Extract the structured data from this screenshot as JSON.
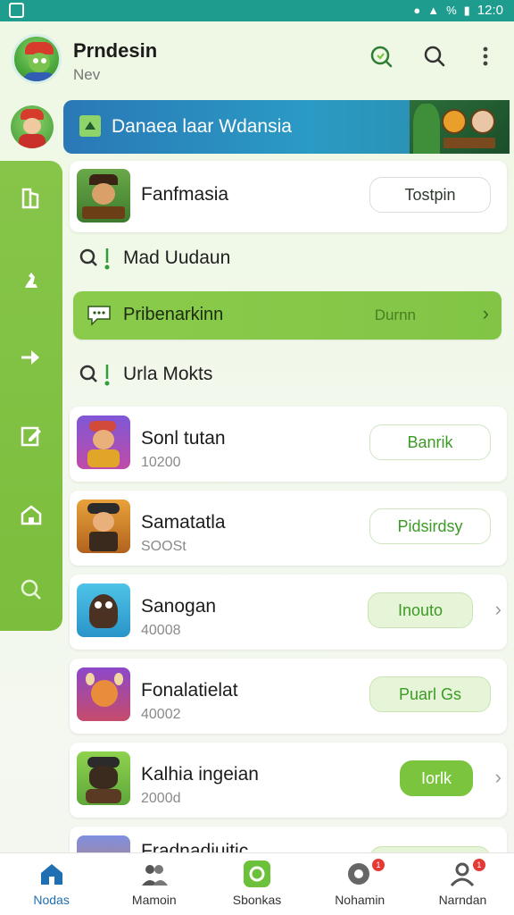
{
  "status_bar": {
    "time": "12:0",
    "signal_text": "%"
  },
  "header": {
    "title": "Prndesin",
    "subtitle": "Nev",
    "actions": [
      "refresh-search-icon",
      "search-icon",
      "more-vert-icon"
    ]
  },
  "banner": {
    "text": "Danaea laar Wdansia"
  },
  "rail": {
    "items": [
      "library-icon",
      "chess-icon",
      "forward-icon",
      "edit-icon",
      "home-icon",
      "settings-icon"
    ]
  },
  "featured": {
    "title": "Fanfmasia",
    "button": "Tostpin"
  },
  "section_1": {
    "label": "Mad Uudaun"
  },
  "highlight": {
    "label": "Pribenarkinn",
    "value": "Durnn"
  },
  "section_2": {
    "label": "Urla Mokts"
  },
  "games": [
    {
      "title": "Sonl tutan",
      "sub": "10200",
      "button": "Banrik",
      "style": "green-outline",
      "chevron": false
    },
    {
      "title": "Samatatla",
      "sub": "SOOSt",
      "button": "Pidsirdsy",
      "style": "green-outline",
      "chevron": false
    },
    {
      "title": "Sanogan",
      "sub": "40008",
      "button": "Inouto",
      "style": "green-soft",
      "chevron": true
    },
    {
      "title": "Fonalatielat",
      "sub": "40002",
      "button": "Puarl Gs",
      "style": "green-soft",
      "chevron": false
    },
    {
      "title": "Kalhia ingeian",
      "sub": "2000d",
      "button": "Iorlk",
      "style": "green-solid",
      "chevron": true
    }
  ],
  "partial_row": {
    "title": "Fradnadiuitic"
  },
  "bottom_nav": [
    {
      "label": "Nodas",
      "active": true,
      "badge": ""
    },
    {
      "label": "Mamoin",
      "active": false,
      "badge": ""
    },
    {
      "label": "Sbonkas",
      "active": false,
      "badge": ""
    },
    {
      "label": "Nohamin",
      "active": false,
      "badge": "1"
    },
    {
      "label": "Narndan",
      "active": false,
      "badge": "1"
    }
  ],
  "colors": {
    "status": "#1e9c8e",
    "accent_green": "#7bc43e",
    "banner_blue": "#2a8fc0",
    "active_nav": "#1f6fb3"
  }
}
